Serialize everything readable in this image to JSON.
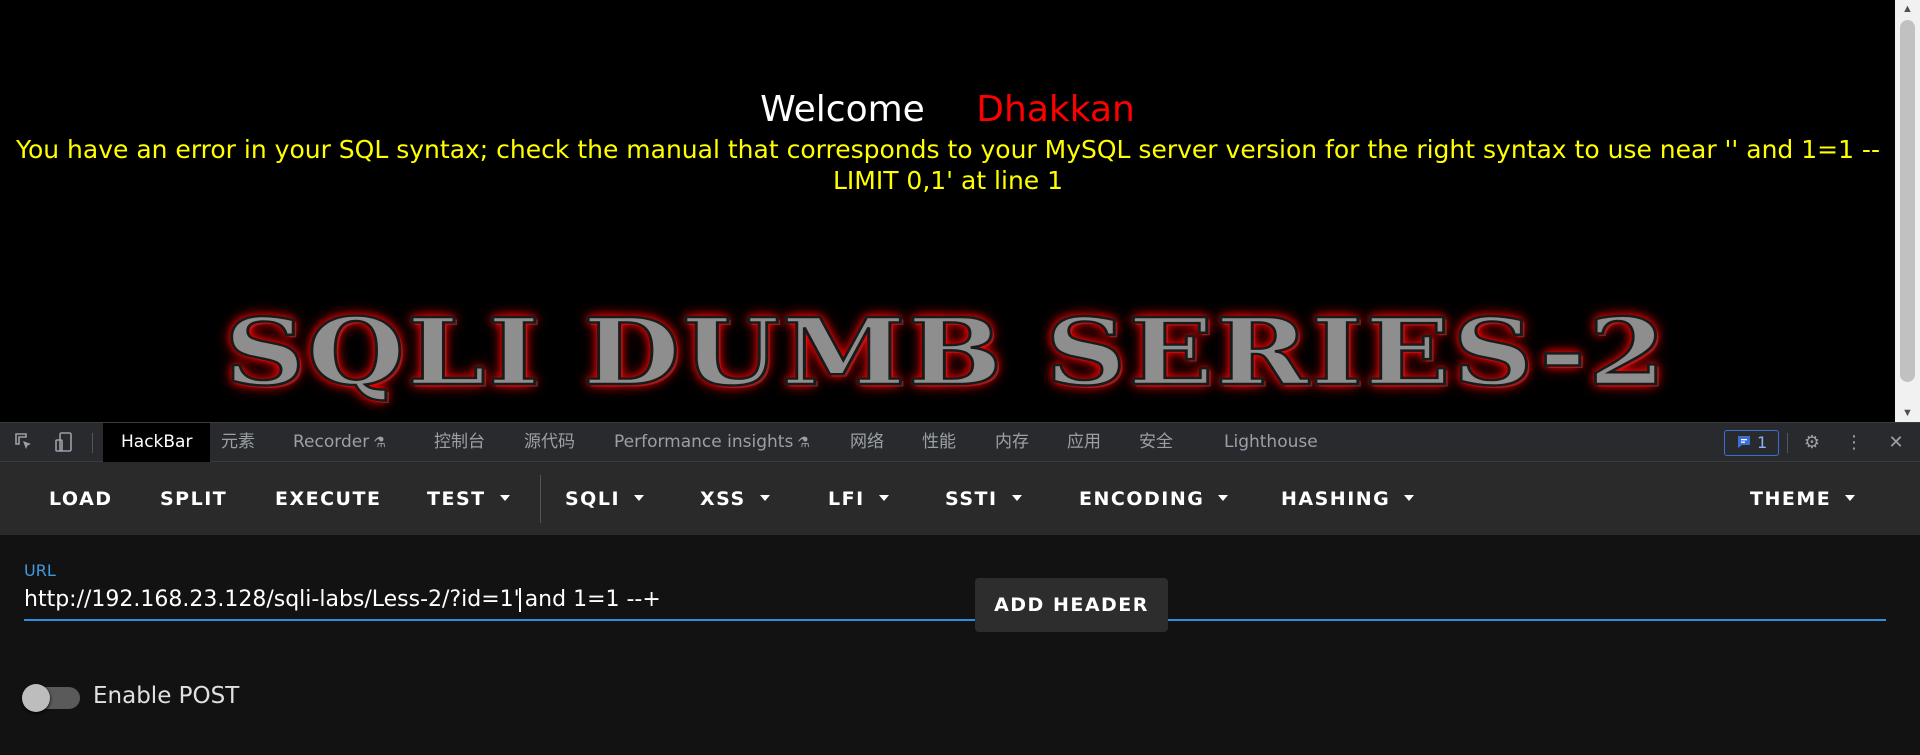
{
  "page": {
    "welcome_word": "Welcome",
    "welcome_name": "Dhakkan",
    "sql_error": "You have an error in your SQL syntax; check the manual that corresponds to your MySQL server version for the right syntax to use near '' and 1=1 -- LIMIT 0,1' at line 1",
    "banner": "SQLI DUMB SERIES-2"
  },
  "devtools": {
    "tabs": [
      {
        "label": "HackBar"
      },
      {
        "label": "元素"
      },
      {
        "label": "Recorder"
      },
      {
        "label": "控制台"
      },
      {
        "label": "源代码"
      },
      {
        "label": "Performance insights"
      },
      {
        "label": "网络"
      },
      {
        "label": "性能"
      },
      {
        "label": "内存"
      },
      {
        "label": "应用"
      },
      {
        "label": "安全"
      },
      {
        "label": "Lighthouse"
      }
    ],
    "issues_count": "1",
    "icons": [
      "inspect-icon",
      "device-toggle-icon",
      "issues-icon",
      "gear-icon",
      "more-vert-icon",
      "close-icon"
    ]
  },
  "hackbar": {
    "toolbar": {
      "load": "LOAD",
      "split": "SPLIT",
      "execute": "EXECUTE",
      "test": "TEST",
      "sqli": "SQLI",
      "xss": "XSS",
      "lfi": "LFI",
      "ssti": "SSTI",
      "encoding": "ENCODING",
      "hashing": "HASHING",
      "theme": "THEME"
    },
    "url_label": "URL",
    "url_before_cursor": "http://192.168.23.128/sqli-labs/Less-2/?id=1'",
    "url_after_cursor": "and 1=1 --+",
    "enable_post_label": "Enable POST",
    "enable_post": false,
    "add_header_label": "ADD HEADER"
  }
}
